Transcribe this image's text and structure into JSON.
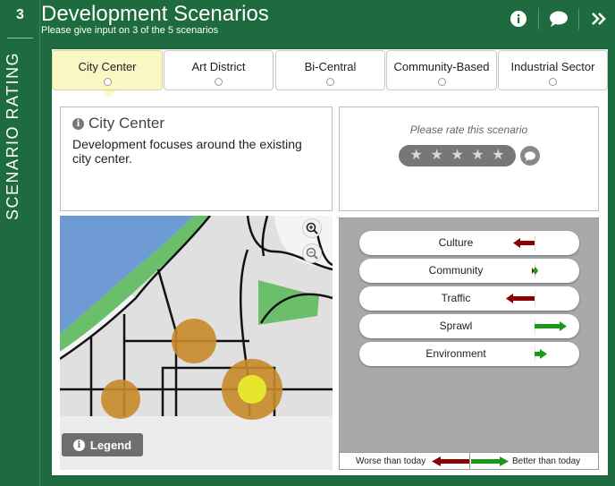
{
  "rail": {
    "step": "3",
    "title": "SCENARIO RATING"
  },
  "header": {
    "title": "Development Scenarios",
    "subtitle": "Please give input on 3 of the 5 scenarios",
    "icons": [
      "info-icon",
      "comment-icon",
      "chevron-double-right-icon"
    ]
  },
  "tabs": [
    {
      "label": "City Center",
      "active": true
    },
    {
      "label": "Art District",
      "active": false
    },
    {
      "label": "Bi-Central",
      "active": false
    },
    {
      "label": "Community-Based",
      "active": false
    },
    {
      "label": "Industrial Sector",
      "active": false
    }
  ],
  "description": {
    "title": "City Center",
    "text": "Development focuses around the existing city center."
  },
  "rating": {
    "prompt": "Please rate this scenario",
    "stars_total": 5,
    "stars_selected": 0
  },
  "map": {
    "legend_label": "Legend"
  },
  "impacts": [
    {
      "label": "Culture",
      "direction": "worse",
      "magnitude": 0.6
    },
    {
      "label": "Community",
      "direction": "neutral",
      "magnitude": 0.1
    },
    {
      "label": "Traffic",
      "direction": "worse",
      "magnitude": 0.8
    },
    {
      "label": "Sprawl",
      "direction": "better",
      "magnitude": 0.9
    },
    {
      "label": "Environment",
      "direction": "better",
      "magnitude": 0.35
    }
  ],
  "scale": {
    "worse": "Worse than today",
    "better": "Better than today"
  },
  "colors": {
    "brand": "#1d6b3f",
    "worse": "#8b0000",
    "better": "#1a9a1a",
    "active_tab": "#fbf7c4"
  }
}
